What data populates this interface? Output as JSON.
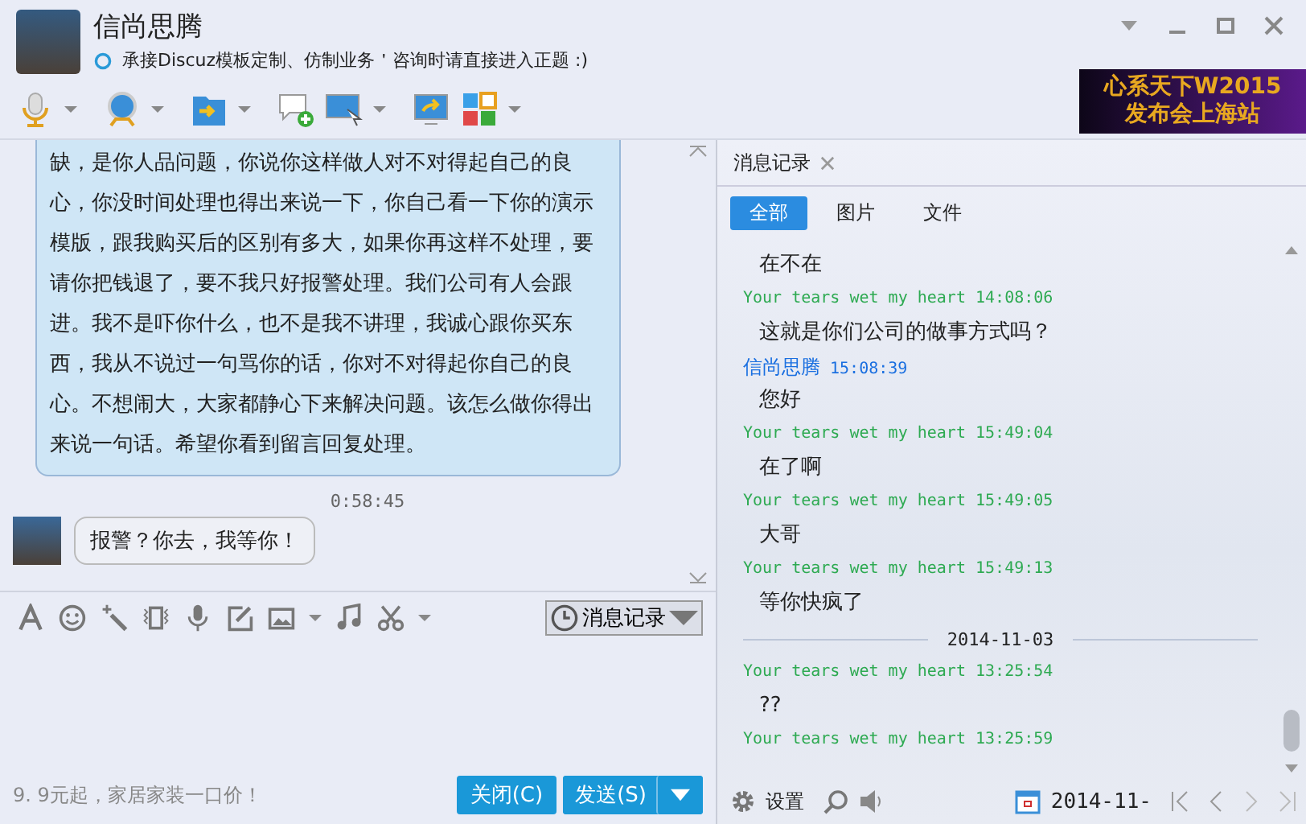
{
  "window": {
    "title": "信尚思腾",
    "status": "承接Discuz模板定制、仿制业务＇咨询时请直接进入正题 :)",
    "banner": [
      "心系天下W2015",
      "发布会上海站"
    ]
  },
  "chat": {
    "messages": [
      {
        "kind": "bubble",
        "text": "缺，是你人品问题，你说你这样做人对不对得起自己的良心，你没时间处理也得出来说一下，你自己看一下你的演示模版，跟我购买后的区别有多大，如果你再这样不处理，要请你把钱退了，要不我只好报警处理。我们公司有人会跟进。我不是吓你什么，也不是我不讲理，我诚心跟你买东西，我从不说过一句骂你的话，你对不对得起你自己的良心。不想闹大，大家都静心下来解决问题。该怎么做你得出来说一句话。希望你看到留言回复处理。"
      },
      {
        "kind": "time",
        "text": "0:58:45"
      },
      {
        "kind": "received",
        "text": "报警？你去，我等你！"
      }
    ]
  },
  "input_toolbar": {
    "history_button": "消息记录"
  },
  "footer": {
    "ad": "9. 9元起，家居家装一口价！",
    "close_button": "关闭(C)",
    "send_button": "发送(S)"
  },
  "history": {
    "tab": "消息记录",
    "filters": [
      {
        "label": "全部",
        "selected": true
      },
      {
        "label": "图片",
        "selected": false
      },
      {
        "label": "文件",
        "selected": false
      }
    ],
    "entries": [
      {
        "kind": "message",
        "text": "在不在"
      },
      {
        "kind": "sender",
        "name": "Your tears wet my heart",
        "time": "14:08:06",
        "color": "#2eaa52"
      },
      {
        "kind": "message",
        "text": "这就是你们公司的做事方式吗？"
      },
      {
        "kind": "sender",
        "name": "信尚思腾",
        "time": "15:08:39",
        "color": "#1a6fe0"
      },
      {
        "kind": "message",
        "text": "您好"
      },
      {
        "kind": "sender",
        "name": "Your tears wet my heart",
        "time": "15:49:04",
        "color": "#2eaa52"
      },
      {
        "kind": "message",
        "text": "在了啊"
      },
      {
        "kind": "sender",
        "name": "Your tears wet my heart",
        "time": "15:49:05",
        "color": "#2eaa52"
      },
      {
        "kind": "message",
        "text": "大哥"
      },
      {
        "kind": "sender",
        "name": "Your tears wet my heart",
        "time": "15:49:13",
        "color": "#2eaa52"
      },
      {
        "kind": "message",
        "text": "等你快疯了"
      },
      {
        "kind": "date",
        "text": "2014-11-03"
      },
      {
        "kind": "sender",
        "name": "Your tears wet my heart",
        "time": "13:25:54",
        "color": "#2eaa52"
      },
      {
        "kind": "message",
        "text": "??"
      },
      {
        "kind": "sender",
        "name": "Your tears wet my heart",
        "time": "13:25:59",
        "color": "#2eaa52"
      }
    ],
    "settings": "设置",
    "date": "2014-11-"
  }
}
